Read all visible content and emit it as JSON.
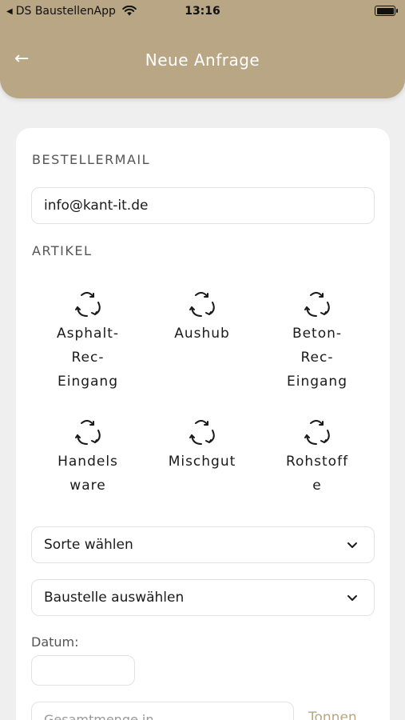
{
  "status_bar": {
    "back_app": "DS BaustellenApp",
    "time": "13:16"
  },
  "header": {
    "title": "Neue Anfrage"
  },
  "form": {
    "email_label": "BESTELLERMAIL",
    "email_value": "info@kant-it.de",
    "article_label": "ARTIKEL",
    "articles": [
      {
        "label": "Asphalt-\nRec-\nEingang",
        "icon": "recycle-icon"
      },
      {
        "label": "Aushub",
        "icon": "recycle-icon"
      },
      {
        "label": "Beton-\nRec-\nEingang",
        "icon": "recycle-icon"
      },
      {
        "label": "Handels\nware",
        "icon": "recycle-icon"
      },
      {
        "label": "Mischgut",
        "icon": "recycle-icon"
      },
      {
        "label": "Rohstoff\ne",
        "icon": "recycle-icon"
      }
    ],
    "sorte_select": "Sorte wählen",
    "baustelle_select": "Baustelle auswählen",
    "datum_label": "Datum:",
    "datum_value": "",
    "menge_placeholder": "Gesamtmenge in",
    "menge_unit": "Tonnen"
  },
  "colors": {
    "header_bg": "#b9a684",
    "accent": "#b9a684",
    "background": "#efefef"
  }
}
